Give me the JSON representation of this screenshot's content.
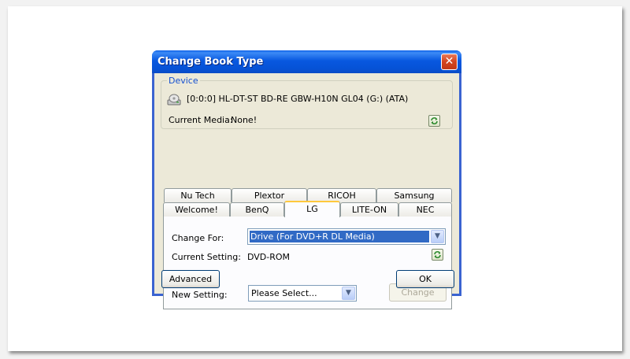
{
  "window": {
    "title": "Change Book Type",
    "close_glyph": "✕"
  },
  "device": {
    "legend": "Device",
    "drive_name": "[0:0:0] HL-DT-ST BD-RE  GBW-H10N GL04 (G:) (ATA)",
    "current_media_label": "Current Media:",
    "current_media_value": "None!"
  },
  "tabs": {
    "row_back": [
      "Nu Tech",
      "Plextor",
      "RICOH",
      "Samsung"
    ],
    "row_front": [
      "Welcome!",
      "BenQ",
      "LG",
      "LITE-ON",
      "NEC"
    ],
    "active": "LG"
  },
  "panel": {
    "change_for_label": "Change For:",
    "change_for_value": "Drive (For DVD+R DL Media)",
    "current_setting_label": "Current Setting:",
    "current_setting_value": "DVD-ROM",
    "new_setting_label": "New Setting:",
    "new_setting_value": "Please Select...",
    "change_button": "Change"
  },
  "footer": {
    "advanced_button": "Advanced",
    "ok_button": "OK"
  },
  "icons": {
    "close": "close-icon",
    "drive": "drive-icon",
    "refresh": "refresh-icon",
    "dropdown": "chevron-down-icon"
  },
  "colors": {
    "title_bar": "#0a5fe8",
    "dialog_bg": "#ece9d8",
    "selection": "#316ac5",
    "accent_tab": "#ffc83c",
    "legend_text": "#1550d0"
  }
}
